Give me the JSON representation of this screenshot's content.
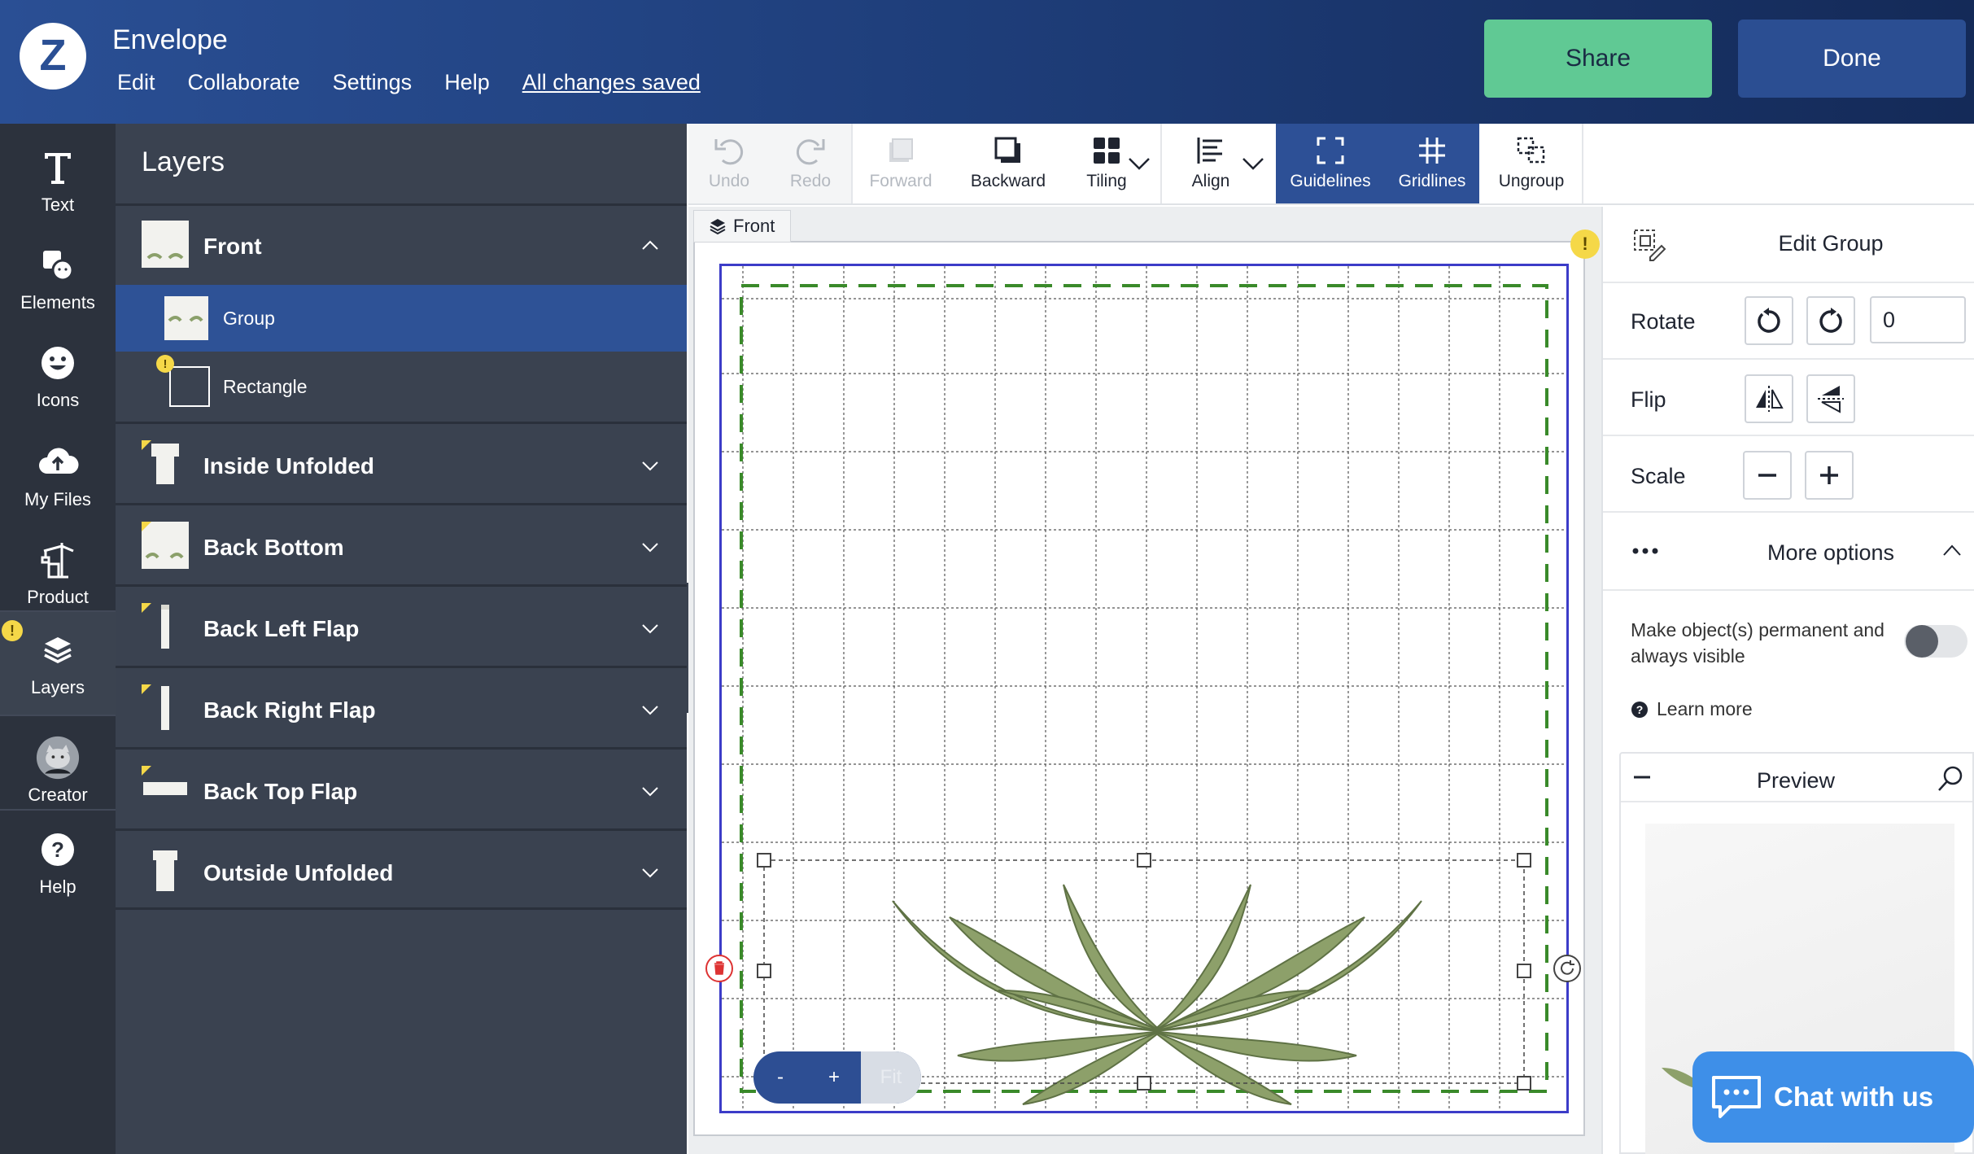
{
  "header": {
    "title": "Envelope",
    "menu": [
      "Edit",
      "Collaborate",
      "Settings",
      "Help"
    ],
    "status": "All changes saved",
    "share_label": "Share",
    "done_label": "Done",
    "share_color": "#60c994",
    "done_color": "#2b4e92"
  },
  "rail": {
    "items": [
      {
        "label": "Text",
        "icon": "text-icon"
      },
      {
        "label": "Elements",
        "icon": "elements-icon"
      },
      {
        "label": "Icons",
        "icon": "smiley-icon"
      },
      {
        "label": "My Files",
        "icon": "upload-cloud-icon"
      },
      {
        "label": "Product",
        "icon": "product-crane-icon"
      },
      {
        "label": "Layers",
        "icon": "layers-icon",
        "active": true
      },
      {
        "label": "Creator",
        "icon": "creator-avatar"
      },
      {
        "label": "Help",
        "icon": "help-icon"
      }
    ]
  },
  "layers": {
    "title": "Layers",
    "front": {
      "label": "Front",
      "expanded": true,
      "children": [
        {
          "label": "Group",
          "selected": true
        },
        {
          "label": "Rectangle",
          "warning": true
        }
      ]
    },
    "sections": [
      "Inside Unfolded",
      "Back Bottom",
      "Back Left Flap",
      "Back Right Flap",
      "Back Top Flap",
      "Outside Unfolded"
    ]
  },
  "toolbar": {
    "undo": "Undo",
    "redo": "Redo",
    "forward": "Forward",
    "backward": "Backward",
    "tiling": "Tiling",
    "align": "Align",
    "guidelines": "Guidelines",
    "gridlines": "Gridlines",
    "ungroup": "Ungroup"
  },
  "canvas": {
    "tab_label": "Front"
  },
  "zoom": {
    "out": "-",
    "in": "+",
    "fit": "Fit"
  },
  "right_panel": {
    "title": "Edit Group",
    "rotate_label": "Rotate",
    "rotate_value": "0",
    "flip_label": "Flip",
    "scale_label": "Scale",
    "more_label": "More options",
    "permanent_text": "Make object(s) permanent and always visible",
    "learn_more": "Learn more",
    "preview_label": "Preview"
  },
  "chat": {
    "label": "Chat with us"
  }
}
